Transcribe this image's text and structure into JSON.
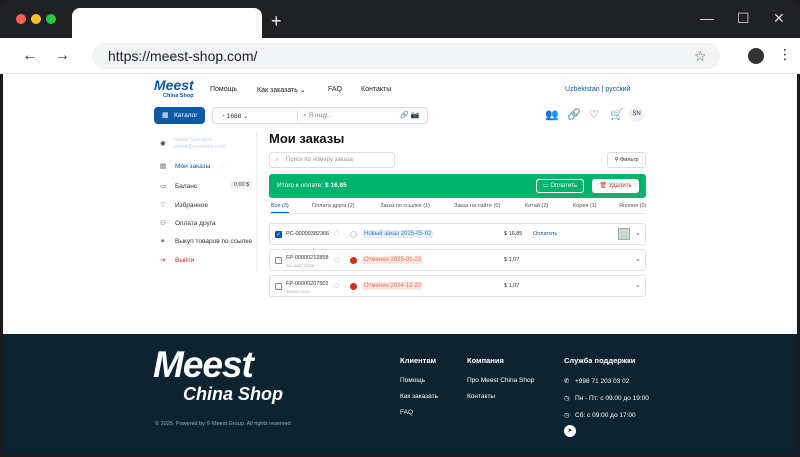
{
  "browser": {
    "url": "https://meest-shop.com/",
    "new_tab_label": "+",
    "minimize": "—",
    "maximize": "☐",
    "close": "✕"
  },
  "header": {
    "logo_main": "Meest",
    "logo_sub": "China Shop",
    "nav": [
      {
        "label": "Помощь"
      },
      {
        "label": "Как заказать"
      },
      {
        "label": "FAQ"
      },
      {
        "label": "Контакты"
      }
    ],
    "language": "Uzbekistan | русский",
    "catalog_label": "Каталог",
    "search_source": "1688",
    "search_placeholder": "Я ищу...",
    "avatar_initials": "SN"
  },
  "sidebar": {
    "user_name": "Name Surname",
    "user_email": "email@example.com",
    "items": [
      {
        "label": "Мои заказы",
        "icon": "orders-icon",
        "active": true
      },
      {
        "label": "Баланс",
        "icon": "wallet-icon",
        "badge": "0.00 $"
      },
      {
        "label": "Избранное",
        "icon": "heart-icon"
      },
      {
        "label": "Оплата друга",
        "icon": "user-plus-icon"
      },
      {
        "label": "Выкуп товаров по ссылке",
        "icon": "link-icon"
      },
      {
        "label": "Выйти",
        "icon": "logout-icon",
        "danger": true
      }
    ]
  },
  "main": {
    "title": "Мои заказы",
    "search_placeholder": "Поиск по номеру заказа",
    "filter_label": "Фильтр",
    "total_label": "Итого к оплате:",
    "total_value": "$ 16,85",
    "pay_label": "Оплатить",
    "delete_label": "Удалить",
    "tabs": [
      {
        "label": "Все (3)",
        "active": true
      },
      {
        "label": "Оплата друга (2)"
      },
      {
        "label": "Заказ по ссылке (1)"
      },
      {
        "label": "Заказ на сайте (0)"
      },
      {
        "label": "Китай (2)"
      },
      {
        "label": "Корея (1)"
      },
      {
        "label": "Япония (0)"
      }
    ],
    "orders": [
      {
        "id": "PC-00000382366",
        "sub": "",
        "status": "Новый заказ 2025-05-02",
        "status_type": "new",
        "price": "$ 16,85",
        "pay": "Оплатить",
        "checked": true,
        "country": "kr"
      },
      {
        "id": "FP-00000212858",
        "sub": "380-058770236",
        "status": "Отменен 2025-01-22",
        "status_type": "cancel",
        "price": "$ 1,07",
        "pay": "",
        "checked": false,
        "country": "cn"
      },
      {
        "id": "FP-00000207502",
        "sub": "381600+0322",
        "status": "Отменен 2024-12-22",
        "status_type": "cancel",
        "price": "$ 1,07",
        "pay": "",
        "checked": false,
        "country": "cn"
      }
    ]
  },
  "footer": {
    "logo_main": "Meest",
    "logo_sub": "China Shop",
    "copyright": "© 2025. Powered by © Meest Group. All rights reserved.",
    "col1_title": "Клиентам",
    "col1_links": [
      "Помощь",
      "Как заказать",
      "FAQ"
    ],
    "col2_title": "Компания",
    "col2_links": [
      "Про Meest China Shop",
      "Контакты"
    ],
    "col3_title": "Служба поддержки",
    "phone": "+998 71 203 03 02",
    "hours_week": "Пн - Пт: с 09:00 до 19:00",
    "hours_sat": "Сб: с 09:00 до 17:00"
  },
  "colors": {
    "brand": "#0c5aa6",
    "green": "#02b36d",
    "footer": "#0e2330"
  }
}
